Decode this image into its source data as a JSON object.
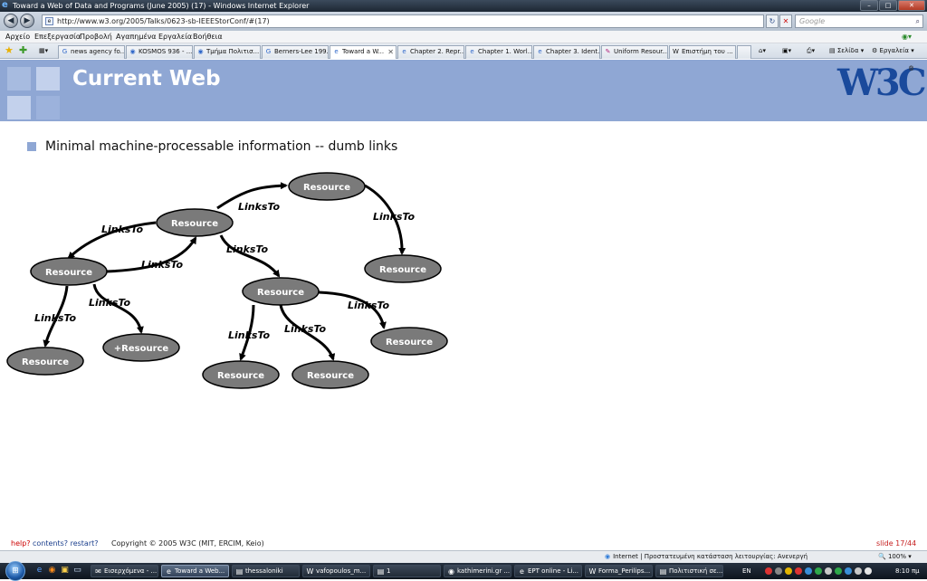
{
  "window": {
    "title": "Toward a Web of Data and Programs (June 2005) (17) - Windows Internet Explorer",
    "minimize": "–",
    "maximize": "□",
    "close": "✕"
  },
  "address_bar": {
    "url": "http://www.w3.org/2005/Talks/0623-sb-IEEEStorConf/#(17)",
    "search_placeholder": "Google",
    "back_icon": "back-arrow-icon",
    "forward_icon": "forward-arrow-icon"
  },
  "menu": [
    "Αρχείο",
    "Επεξεργασία",
    "Προβολή",
    "Αγαπημένα",
    "Εργαλεία",
    "Βοήθεια"
  ],
  "tabs": [
    {
      "label": "news agency fo...",
      "icon": "G"
    },
    {
      "label": "KOSMOS 936 - ...",
      "icon": "◉"
    },
    {
      "label": "Τμήμα Πολιτισ...",
      "icon": "◉"
    },
    {
      "label": "Berners-Lee 199...",
      "icon": "G"
    },
    {
      "label": "Toward a W...",
      "icon": "e",
      "active": true
    },
    {
      "label": "Chapter 2. Repr...",
      "icon": "e"
    },
    {
      "label": "Chapter 1. Worl...",
      "icon": "e"
    },
    {
      "label": "Chapter 3. Ident...",
      "icon": "e"
    },
    {
      "label": "Uniform Resour...",
      "icon": "✎"
    },
    {
      "label": "Επιστήμη του ...",
      "icon": "W"
    }
  ],
  "toolbar": {
    "page_label": "Σελίδα",
    "tools_label": "Εργαλεία"
  },
  "slide": {
    "title": "Current Web",
    "logo_text": "W3C",
    "logo_reg": "®",
    "bullet": "Minimal machine-processable information -- dumb links",
    "diagram": {
      "nodes": [
        {
          "id": "n1",
          "label": "Resource"
        },
        {
          "id": "n2",
          "label": "Resource"
        },
        {
          "id": "n3",
          "label": "Resource"
        },
        {
          "id": "n4",
          "label": "Resource"
        },
        {
          "id": "n5",
          "label": "Resource"
        },
        {
          "id": "n6",
          "label": "Resource"
        },
        {
          "id": "n7",
          "label": "+Resource"
        },
        {
          "id": "n8",
          "label": "Resource"
        },
        {
          "id": "n9",
          "label": "Resource"
        },
        {
          "id": "n10",
          "label": "Resource"
        }
      ],
      "edge_label": "LinksTo"
    },
    "footer": {
      "help": "help?",
      "contents": "contents? restart?",
      "copyright": "Copyright © 2005 W3C (MIT, ERCIM, Keio)",
      "slide_number": "slide 17/44"
    }
  },
  "status_bar": {
    "zone": "Internet | Προστατευμένη κατάσταση λειτουργίας: Ανενεργή",
    "zoom": "100%"
  },
  "taskbar": {
    "tasks": [
      {
        "label": "Εισερχόμενα - ...",
        "icon": "✉"
      },
      {
        "label": "Toward a Web...",
        "icon": "e",
        "active": true
      },
      {
        "label": "thessaloniki",
        "icon": "▤"
      },
      {
        "label": "vafopoulos_m...",
        "icon": "W"
      },
      {
        "label": "1",
        "icon": "▤"
      },
      {
        "label": "kathimerini.gr ...",
        "icon": "◉"
      },
      {
        "label": "EPT online - Li...",
        "icon": "e"
      },
      {
        "label": "Forma_Perilips...",
        "icon": "W"
      },
      {
        "label": "Πολιτιστική σε...",
        "icon": "▤"
      }
    ],
    "language": "EN",
    "clock": "8:10 πμ"
  }
}
